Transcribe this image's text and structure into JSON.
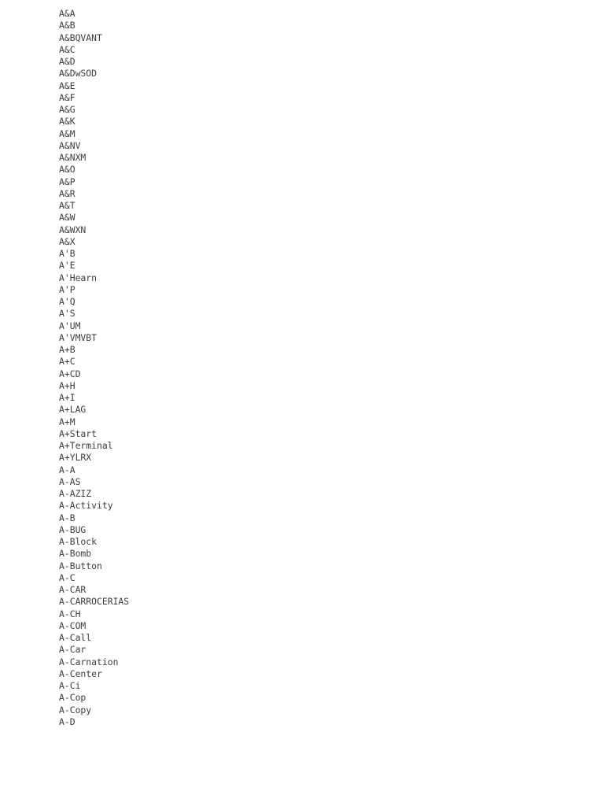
{
  "document": {
    "background_color": "#ffffff",
    "text_color": "#3c3c3c",
    "entry_count": 60
  },
  "entries": [
    {
      "label": "A&A"
    },
    {
      "label": "A&B"
    },
    {
      "label": "A&BQVANT"
    },
    {
      "label": "A&C"
    },
    {
      "label": "A&D"
    },
    {
      "label": "A&DwSOD"
    },
    {
      "label": "A&E"
    },
    {
      "label": "A&F"
    },
    {
      "label": "A&G"
    },
    {
      "label": "A&K"
    },
    {
      "label": "A&M"
    },
    {
      "label": "A&NV"
    },
    {
      "label": "A&NXM"
    },
    {
      "label": "A&O"
    },
    {
      "label": "A&P"
    },
    {
      "label": "A&R"
    },
    {
      "label": "A&T"
    },
    {
      "label": "A&W"
    },
    {
      "label": "A&WXN"
    },
    {
      "label": "A&X"
    },
    {
      "label": "A'B"
    },
    {
      "label": "A'E"
    },
    {
      "label": "A'Hearn"
    },
    {
      "label": "A'P"
    },
    {
      "label": "A'Q"
    },
    {
      "label": "A'S"
    },
    {
      "label": "A'UM"
    },
    {
      "label": "A'VMVBT"
    },
    {
      "label": "A+B"
    },
    {
      "label": "A+C"
    },
    {
      "label": "A+CD"
    },
    {
      "label": "A+H"
    },
    {
      "label": "A+I"
    },
    {
      "label": "A+LAG"
    },
    {
      "label": "A+M"
    },
    {
      "label": "A+Start"
    },
    {
      "label": "A+Terminal"
    },
    {
      "label": "A+YLRX"
    },
    {
      "label": "A-A"
    },
    {
      "label": "A-AS"
    },
    {
      "label": "A-AZIZ"
    },
    {
      "label": "A-Activity"
    },
    {
      "label": "A-B"
    },
    {
      "label": "A-BUG"
    },
    {
      "label": "A-Block"
    },
    {
      "label": "A-Bomb"
    },
    {
      "label": "A-Button"
    },
    {
      "label": "A-C"
    },
    {
      "label": "A-CAR"
    },
    {
      "label": "A-CARROCERIAS"
    },
    {
      "label": "A-CH"
    },
    {
      "label": "A-COM"
    },
    {
      "label": "A-Call"
    },
    {
      "label": "A-Car"
    },
    {
      "label": "A-Carnation"
    },
    {
      "label": "A-Center"
    },
    {
      "label": "A-Ci"
    },
    {
      "label": "A-Cop"
    },
    {
      "label": "A-Copy"
    },
    {
      "label": "A-D"
    }
  ]
}
